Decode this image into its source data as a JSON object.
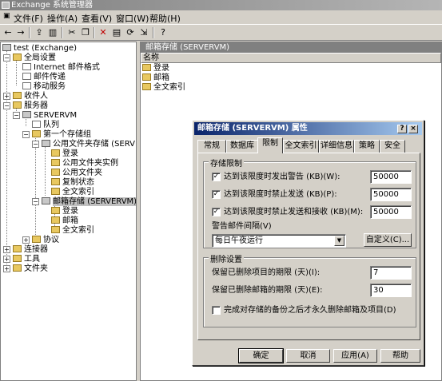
{
  "window": {
    "title": "Exchange 系统管理器"
  },
  "menu": [
    {
      "label": "文件(F)"
    },
    {
      "label": "操作(A)"
    },
    {
      "label": "查看(V)"
    },
    {
      "label": "窗口(W)"
    },
    {
      "label": "帮助(H)"
    }
  ],
  "tree": {
    "root": "test (Exchange)",
    "global_settings": "全局设置",
    "internet_format": "Internet 邮件格式",
    "message_delivery": "邮件传递",
    "mobile_services": "移动服务",
    "recipients": "收件人",
    "servers": "服务器",
    "server_name": "SERVERVM",
    "queues": "队列",
    "first_storage_group": "第一个存储组",
    "public_folder_store": "公用文件夹存储 (SERVERV",
    "pf_logons": "登录",
    "pf_instances": "公用文件夹实例",
    "pf_folders": "公用文件夹",
    "pf_replication": "复制状态",
    "pf_fulltext": "全文索引",
    "mailbox_store": "邮箱存储 (SERVERVM)",
    "mb_logons": "登录",
    "mb_mailboxes": "邮箱",
    "mb_fulltext": "全文索引",
    "protocols": "协议",
    "connectors": "连接器",
    "tools": "工具",
    "folders": "文件夹"
  },
  "right_pane": {
    "header": "邮箱存储 (SERVERVM)",
    "column": "名称",
    "items": [
      "登录",
      "邮箱",
      "全文索引"
    ]
  },
  "dialog": {
    "title": "邮箱存储 (SERVERVM) 属性",
    "help_btn": "?",
    "close_btn": "×",
    "tabs": [
      "常规",
      "数据库",
      "限制",
      "全文索引",
      "详细信息",
      "策略",
      "安全"
    ],
    "storage_limits_title": "存储限制",
    "warn_label": "达到该限度时发出警告 (KB)(W):",
    "warn_value": "50000",
    "prohibit_send_label": "达到该限度时禁止发送 (KB)(P):",
    "prohibit_send_value": "50000",
    "prohibit_sr_label": "达到该限度时禁止发送和接收 (KB)(M):",
    "prohibit_sr_value": "50000",
    "warn_interval_label": "警告邮件间隔(V)",
    "warn_interval_value": "每日午夜运行",
    "customize_btn": "自定义(C)...",
    "deletion_title": "删除设置",
    "keep_items_label": "保留已删除项目的期限 (天)(I):",
    "keep_items_value": "7",
    "keep_mailboxes_label": "保留已删除邮箱的期限 (天)(E):",
    "keep_mailboxes_value": "30",
    "backup_label": "完成对存储的备份之后才永久删除邮箱及项目(D)",
    "ok": "确定",
    "cancel": "取消",
    "apply": "应用(A)",
    "help": "帮助"
  }
}
